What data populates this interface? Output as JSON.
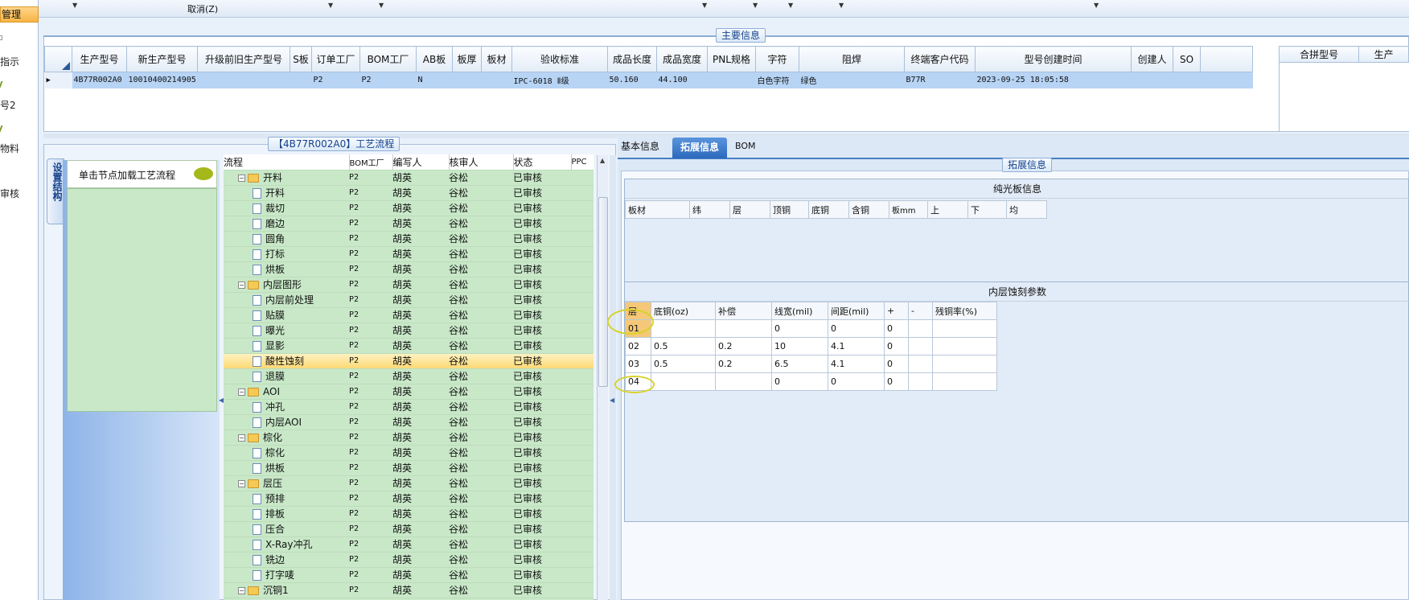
{
  "toolbar": {
    "cancel_label": "取消(Z)"
  },
  "leftnav": {
    "selected": "管理",
    "items": [
      "指示",
      "号2",
      "物料",
      "审核"
    ]
  },
  "main_info": {
    "title": "主要信息",
    "columns": [
      "生产型号",
      "新生产型号",
      "升级前旧生产型号",
      "S板",
      "订单工厂",
      "BOM工厂",
      "AB板",
      "板厚",
      "板材",
      "验收标准",
      "成品长度",
      "成品宽度",
      "PNL规格",
      "字符",
      "阻焊",
      "终端客户代码",
      "型号创建时间",
      "创建人",
      "SO"
    ],
    "row": [
      "4B77R002A0",
      "10010400214905",
      "",
      "",
      "P2",
      "P2",
      "N",
      "",
      "",
      "IPC-6018 Ⅱ级",
      "50.160",
      "44.100",
      "",
      "白色字符",
      "绿色",
      "B77R",
      "2023-09-25 18:05:58",
      "",
      ""
    ],
    "side_columns": [
      "合拼型号",
      "生产"
    ]
  },
  "process": {
    "title": "【4B77R002A0】工艺流程",
    "vertical_tab": "设置结构",
    "hint": "单击节点加载工艺流程",
    "columns": [
      "流程",
      "BOM工厂",
      "编写人",
      "核审人",
      "状态",
      "PPC"
    ],
    "rows": [
      {
        "name": "开料",
        "level": 0,
        "folder": true,
        "bom": "P2",
        "writer": "胡英",
        "reviewer": "谷松",
        "status": "已审核"
      },
      {
        "name": "开料",
        "level": 1,
        "folder": false,
        "bom": "P2",
        "writer": "胡英",
        "reviewer": "谷松",
        "status": "已审核"
      },
      {
        "name": "裁切",
        "level": 1,
        "folder": false,
        "bom": "P2",
        "writer": "胡英",
        "reviewer": "谷松",
        "status": "已审核"
      },
      {
        "name": "磨边",
        "level": 1,
        "folder": false,
        "bom": "P2",
        "writer": "胡英",
        "reviewer": "谷松",
        "status": "已审核"
      },
      {
        "name": "圆角",
        "level": 1,
        "folder": false,
        "bom": "P2",
        "writer": "胡英",
        "reviewer": "谷松",
        "status": "已审核"
      },
      {
        "name": "打标",
        "level": 1,
        "folder": false,
        "bom": "P2",
        "writer": "胡英",
        "reviewer": "谷松",
        "status": "已审核"
      },
      {
        "name": "烘板",
        "level": 1,
        "folder": false,
        "bom": "P2",
        "writer": "胡英",
        "reviewer": "谷松",
        "status": "已审核"
      },
      {
        "name": "内层图形",
        "level": 0,
        "folder": true,
        "bom": "P2",
        "writer": "胡英",
        "reviewer": "谷松",
        "status": "已审核"
      },
      {
        "name": "内层前处理",
        "level": 1,
        "folder": false,
        "bom": "P2",
        "writer": "胡英",
        "reviewer": "谷松",
        "status": "已审核"
      },
      {
        "name": "贴膜",
        "level": 1,
        "folder": false,
        "bom": "P2",
        "writer": "胡英",
        "reviewer": "谷松",
        "status": "已审核"
      },
      {
        "name": "曝光",
        "level": 1,
        "folder": false,
        "bom": "P2",
        "writer": "胡英",
        "reviewer": "谷松",
        "status": "已审核"
      },
      {
        "name": "显影",
        "level": 1,
        "folder": false,
        "bom": "P2",
        "writer": "胡英",
        "reviewer": "谷松",
        "status": "已审核"
      },
      {
        "name": "酸性蚀刻",
        "level": 1,
        "folder": false,
        "bom": "P2",
        "writer": "胡英",
        "reviewer": "谷松",
        "status": "已审核",
        "selected": true
      },
      {
        "name": "退膜",
        "level": 1,
        "folder": false,
        "bom": "P2",
        "writer": "胡英",
        "reviewer": "谷松",
        "status": "已审核"
      },
      {
        "name": "AOI",
        "level": 0,
        "folder": true,
        "bom": "P2",
        "writer": "胡英",
        "reviewer": "谷松",
        "status": "已审核"
      },
      {
        "name": "冲孔",
        "level": 1,
        "folder": false,
        "bom": "P2",
        "writer": "胡英",
        "reviewer": "谷松",
        "status": "已审核"
      },
      {
        "name": "内层AOI",
        "level": 1,
        "folder": false,
        "bom": "P2",
        "writer": "胡英",
        "reviewer": "谷松",
        "status": "已审核"
      },
      {
        "name": "棕化",
        "level": 0,
        "folder": true,
        "bom": "P2",
        "writer": "胡英",
        "reviewer": "谷松",
        "status": "已审核"
      },
      {
        "name": "棕化",
        "level": 1,
        "folder": false,
        "bom": "P2",
        "writer": "胡英",
        "reviewer": "谷松",
        "status": "已审核"
      },
      {
        "name": "烘板",
        "level": 1,
        "folder": false,
        "bom": "P2",
        "writer": "胡英",
        "reviewer": "谷松",
        "status": "已审核"
      },
      {
        "name": "层压",
        "level": 0,
        "folder": true,
        "bom": "P2",
        "writer": "胡英",
        "reviewer": "谷松",
        "status": "已审核"
      },
      {
        "name": "预排",
        "level": 1,
        "folder": false,
        "bom": "P2",
        "writer": "胡英",
        "reviewer": "谷松",
        "status": "已审核"
      },
      {
        "name": "排板",
        "level": 1,
        "folder": false,
        "bom": "P2",
        "writer": "胡英",
        "reviewer": "谷松",
        "status": "已审核"
      },
      {
        "name": "压合",
        "level": 1,
        "folder": false,
        "bom": "P2",
        "writer": "胡英",
        "reviewer": "谷松",
        "status": "已审核"
      },
      {
        "name": "X-Ray冲孔",
        "level": 1,
        "folder": false,
        "bom": "P2",
        "writer": "胡英",
        "reviewer": "谷松",
        "status": "已审核"
      },
      {
        "name": "铣边",
        "level": 1,
        "folder": false,
        "bom": "P2",
        "writer": "胡英",
        "reviewer": "谷松",
        "status": "已审核"
      },
      {
        "name": "打字唛",
        "level": 1,
        "folder": false,
        "bom": "P2",
        "writer": "胡英",
        "reviewer": "谷松",
        "status": "已审核"
      },
      {
        "name": "沉铜1",
        "level": 0,
        "folder": true,
        "bom": "P2",
        "writer": "胡英",
        "reviewer": "谷松",
        "status": "已审核"
      }
    ]
  },
  "tabs": [
    {
      "label": "基本信息",
      "active": false
    },
    {
      "label": "拓展信息",
      "active": true
    },
    {
      "label": "BOM",
      "active": false
    }
  ],
  "ext_info": {
    "title": "拓展信息",
    "plain": {
      "title": "纯光板信息",
      "columns": [
        "板材",
        "纬",
        "层",
        "顶铜",
        "底铜",
        "含铜",
        "板mm",
        "上",
        "下",
        "均"
      ]
    },
    "inner": {
      "title": "内层蚀刻参数",
      "columns": [
        "层",
        "底铜(oz)",
        "补偿",
        "线宽(mil)",
        "间距(mil)",
        "+",
        "-",
        "残铜率(%)"
      ],
      "rows": [
        [
          "01",
          "",
          "",
          "0",
          "0",
          "0",
          "",
          ""
        ],
        [
          "02",
          "0.5",
          "0.2",
          "10",
          "4.1",
          "0",
          "",
          ""
        ],
        [
          "03",
          "0.5",
          "0.2",
          "6.5",
          "4.1",
          "0",
          "",
          ""
        ],
        [
          "04",
          "",
          "",
          "0",
          "0",
          "0",
          "",
          ""
        ]
      ]
    }
  }
}
